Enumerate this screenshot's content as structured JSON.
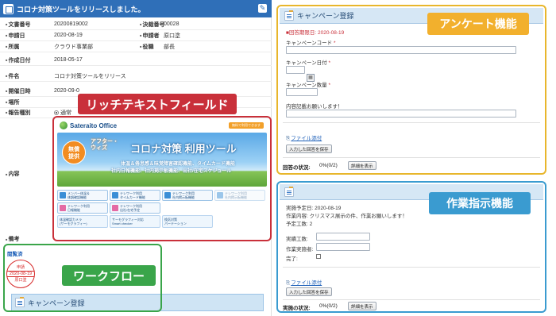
{
  "document": {
    "title": "コロナ対策ツールをリリースしました。",
    "fields": [
      {
        "label": "文書番号",
        "value": "20200819002",
        "label2": "決裁番号",
        "value2": "00028"
      },
      {
        "label": "申請日",
        "value": "2020-08-19",
        "label2": "申請者",
        "value2": "原口塗"
      },
      {
        "label": "所属",
        "value": "クラウド事業部",
        "label2": "役職",
        "value2": "部長"
      },
      {
        "label": "作成日付",
        "value": "2018-05-17"
      },
      {
        "label": "件名",
        "value": "コロナ対策ツールをリリース"
      },
      {
        "label": "開催日時",
        "value": "2020-09-0"
      },
      {
        "label": "場所",
        "value": ""
      },
      {
        "label": "報告種別",
        "value": "通常"
      },
      {
        "label": "内容",
        "value": ""
      },
      {
        "label": "備考",
        "value": ""
      }
    ],
    "approval_label": "閲覧済",
    "stamp": {
      "top": "申請",
      "date": "2020-08-19",
      "name": "原口塗"
    },
    "campaign_strip_title": "キャンペーン登録"
  },
  "banner": {
    "logo_text": "Sateraito Office",
    "tag": "無料で利用できます",
    "free_badge": "無償\n提供",
    "after_text": "アフター・\nウィズ",
    "title": "コロナ対策 利用ツール",
    "line1": "体温＆倦怠感＆味覚障害確認機能、タイムカード機能",
    "line2": "社内日報機能、社内掲示板機能、出社/在宅スケジュール",
    "buttons": [
      {
        "label": "メンバー体温＆\n体調確認機能",
        "style": "blue"
      },
      {
        "label": "テレワーク利用\nタイムカード機能",
        "style": "blue"
      },
      {
        "label": "テレワーク利用\n社内掲示板機能",
        "style": "blue"
      },
      {
        "label": "テレワーク利用\n社内掲示板機能",
        "style": "dim"
      },
      {
        "label": "テレワーク利用\n日報機能",
        "style": "pink"
      },
      {
        "label": "テレワーク利用\n出社/在宅予定",
        "style": "pink"
      }
    ],
    "promos": [
      {
        "label": "体温確認カメラ\n(サーモグラフィー)"
      },
      {
        "label": "サーモグラフィー対応\nSmart checker"
      },
      {
        "label": "換気対策\nパーテーション"
      }
    ]
  },
  "callouts": {
    "rich_text": "リッチテキストフィールド",
    "workflow": "ワークフロー",
    "survey": "アンケート機能",
    "task": "作業指示機能"
  },
  "survey_panel": {
    "title": "キャンペーン登録",
    "deadline": "■回答期限日: 2020-08-19",
    "fields": [
      {
        "label": "キャンペーンコード",
        "required": true
      },
      {
        "label": "キャンペーン日付",
        "required": true
      },
      {
        "label": "キャンペーン数量",
        "required": true
      },
      {
        "label": "内容記載お願いします！",
        "required": false
      }
    ],
    "attach_link": "ファイル添付",
    "save_button": "入力した回答を保存",
    "status_label": "回答の状況:",
    "status_value": "0%(0/2)",
    "details_button": "詳細を表示"
  },
  "task_panel": {
    "planned_date": "実施予定日: 2020-08-19",
    "task_content": "作業内容: クリスマス展示の件、作業お願いします！",
    "planned_hours": "予定工数: 2",
    "actual_hours_label": "実績工数:",
    "worker_label": "作業実施者:",
    "done_label": "完了:",
    "attach_link": "ファイル添付",
    "save_button": "入力した回答を保存",
    "status_label": "実施の状況:",
    "status_value": "0%(0/2)",
    "details_button": "詳細を表示"
  }
}
